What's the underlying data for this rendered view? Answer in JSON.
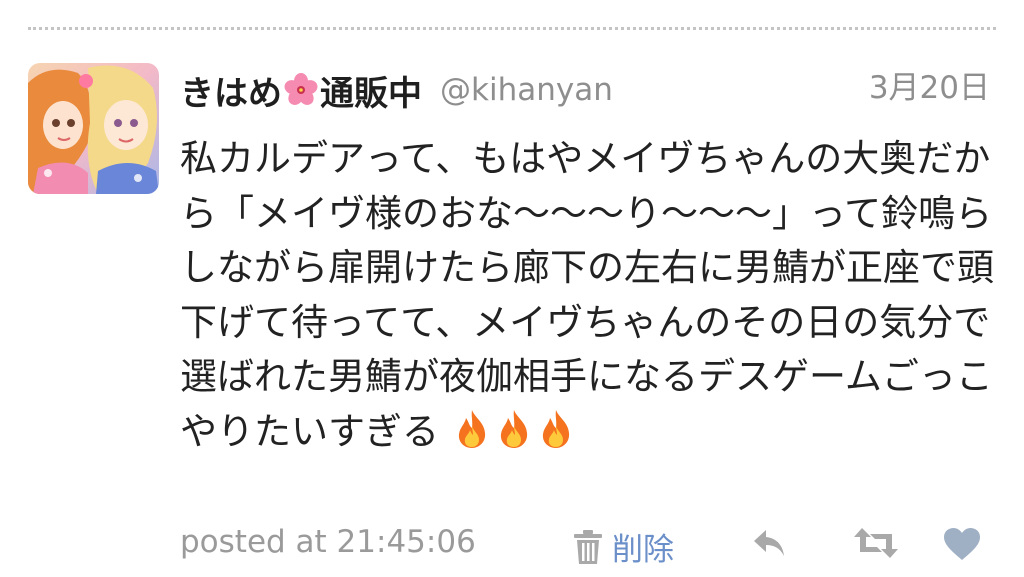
{
  "tweet": {
    "display_name_part1": "きはめ",
    "display_name_part2": "通販中",
    "handle": "@kihanyan",
    "date": "3月20日",
    "body": "私カルデアって、もはやメイヴちゃんの大奥だから「メイヴ様のおな〜〜〜り〜〜〜」って鈴鳴らしながら扉開けたら廊下の左右に男鯖が正座で頭下げて待ってて、メイヴちゃんのその日の気分で選ばれた男鯖が夜伽相手になるデスゲームごっこやりたいすぎる",
    "posted_at": "posted at 21:45:06",
    "delete_label": "削除"
  },
  "icons": {
    "avatar": "user-avatar-anime",
    "name_emoji": "hibiscus-flower-icon",
    "body_emoji": [
      "fire-icon",
      "fire-icon",
      "fire-icon"
    ],
    "actions": [
      "trash-icon",
      "reply-icon",
      "retweet-icon",
      "heart-icon"
    ]
  },
  "colors": {
    "text": "#222222",
    "muted": "#8e8e8e",
    "link": "#6b8fc9",
    "icon_gray": "#a9a9a9",
    "heart": "#9fb0c4"
  }
}
